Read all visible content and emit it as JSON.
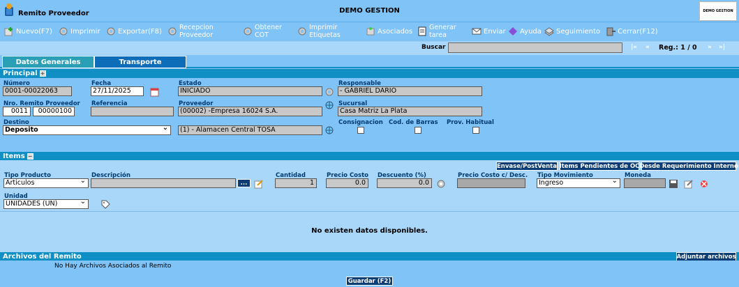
{
  "app": {
    "title": "Remito Proveedor",
    "company": "DEMO GESTION",
    "brand": "DEMO GESTION"
  },
  "toolbar": {
    "nuevo": "Nuevo(F7)",
    "imprimir": "Imprimir",
    "exportar": "Exportar(F8)",
    "recepcion_1": "Recepcion",
    "recepcion_2": "Proveedor",
    "obtener_1": "Obtener",
    "obtener_2": "COT",
    "imprimir_et_1": "Imprimir",
    "imprimir_et_2": "Etiquetas",
    "asociados": "Asociados",
    "generar_1": "Generar",
    "generar_2": "tarea",
    "enviar": "Enviar",
    "ayuda": "Ayuda",
    "seguimiento": "Seguimiento",
    "cerrar": "Cerrar(F12)"
  },
  "search": {
    "label": "Buscar",
    "value": "",
    "first": "|«",
    "prev": "«",
    "reg": "Reg.: 1 / 0",
    "next": "»",
    "last": "»|"
  },
  "tabs": {
    "datos": "Datos Generales",
    "transporte": "Transporte"
  },
  "principal": {
    "title": "Principal",
    "numero_label": "Número",
    "numero": "0001-00022063",
    "fecha_label": "Fecha",
    "fecha": "27/11/2025",
    "estado_label": "Estado",
    "estado": "INICIADO",
    "responsable_label": "Responsable",
    "responsable": "- GABRIEL DARIO",
    "nro_remito_label": "Nro. Remito Proveedor",
    "nro_remito_1": "0011",
    "nro_remito_2": "00000100",
    "referencia_label": "Referencia",
    "referencia": "",
    "proveedor_label": "Proveedor",
    "proveedor": "(00002) -Empresa 16024 S.A.",
    "sucursal_label": "Sucursal",
    "sucursal": "Casa Matriz La Plata",
    "destino_label": "Destino",
    "destino": "Deposito",
    "deposito": "(1) - Alamacen Central TOSA",
    "consignacion_label": "Consignacion",
    "cod_barras_label": "Cod. de Barras",
    "prov_habitual_label": "Prov. Habitual"
  },
  "items": {
    "title": "Items",
    "btn_envase": "Envase/PostVenta",
    "btn_pendientes": "Items Pendientes de OC",
    "btn_requerimiento": "Desde Requerimiento Interno",
    "tipo_producto_label": "Tipo Producto",
    "tipo_producto": "Articulos",
    "descripcion_label": "Descripción",
    "descripcion": "",
    "dots": "...",
    "cantidad_label": "Cantidad",
    "cantidad": "1",
    "precio_costo_label": "Precio Costo",
    "precio_costo": "0.0",
    "descuento_label": "Descuento (%)",
    "descuento": "0.0",
    "precio_desc_label": "Precio Costo c/ Desc.",
    "precio_desc": "",
    "tipo_mov_label": "Tipo Movimiento",
    "tipo_mov": "Ingreso",
    "moneda_label": "Moneda",
    "moneda": "",
    "unidad_label": "Unidad",
    "unidad": "UNIDADES (UN)",
    "nodata": "No existen datos disponibles."
  },
  "archivos": {
    "title": "Archivos del Remito",
    "adjuntar": "Adjuntar archivos",
    "empty": "No Hay Archivos Asociados al Remito"
  },
  "guardar": "Guardar (F2)"
}
